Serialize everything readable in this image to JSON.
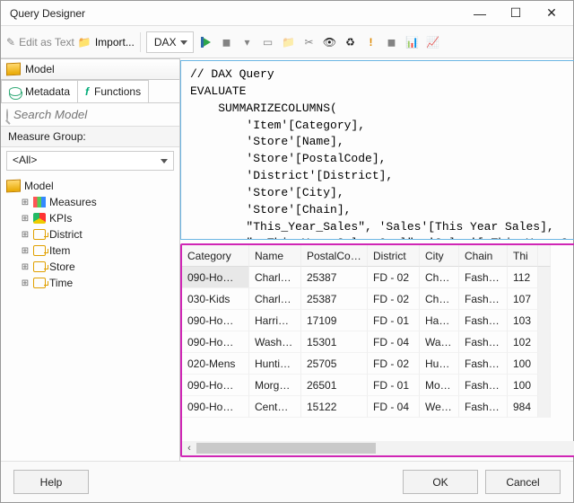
{
  "window": {
    "title": "Query Designer"
  },
  "toolbar": {
    "edit_as_text": "Edit as Text",
    "import": "Import...",
    "language": "DAX"
  },
  "left_panel": {
    "model_header": "Model",
    "tabs": {
      "metadata": "Metadata",
      "functions": "Functions"
    },
    "search_placeholder": "Search Model",
    "measure_group_label": "Measure Group:",
    "measure_group_value": "<All>",
    "tree": {
      "root": "Model",
      "children": [
        {
          "label": "Measures",
          "icon": "measures"
        },
        {
          "label": "KPIs",
          "icon": "kpis"
        },
        {
          "label": "District",
          "icon": "dim"
        },
        {
          "label": "Item",
          "icon": "dim"
        },
        {
          "label": "Store",
          "icon": "dim"
        },
        {
          "label": "Time",
          "icon": "dim"
        }
      ]
    }
  },
  "query": {
    "lines": [
      "// DAX Query",
      "EVALUATE",
      "    SUMMARIZECOLUMNS(",
      "        'Item'[Category],",
      "        'Store'[Name],",
      "        'Store'[PostalCode],",
      "        'District'[District],",
      "        'Store'[City],",
      "        'Store'[Chain],",
      "        \"This_Year_Sales\", 'Sales'[This Year Sales],",
      "        \"v_This_Year_Sales_Goal\", 'Sales'[_This Year Sales Goal],"
    ]
  },
  "grid": {
    "columns": [
      "Category",
      "Name",
      "PostalCode",
      "District",
      "City",
      "Chain",
      "Thi"
    ],
    "rows": [
      [
        "090-Ho…",
        "Charl…",
        "25387",
        "FD - 02",
        "Ch…",
        "Fashi…",
        "112"
      ],
      [
        "030-Kids",
        "Charl…",
        "25387",
        "FD - 02",
        "Ch…",
        "Fashi…",
        "107"
      ],
      [
        "090-Ho…",
        "Harri…",
        "17109",
        "FD - 01",
        "Ha…",
        "Fashi…",
        "103"
      ],
      [
        "090-Ho…",
        "Wash…",
        "15301",
        "FD - 04",
        "Wa…",
        "Fashi…",
        "102"
      ],
      [
        "020-Mens",
        "Hunti…",
        "25705",
        "FD - 02",
        "Hu…",
        "Fashi…",
        "100"
      ],
      [
        "090-Ho…",
        "Morg…",
        "26501",
        "FD - 01",
        "Mo…",
        "Fashi…",
        "100"
      ],
      [
        "090-Ho…",
        "Cent…",
        "15122",
        "FD - 04",
        "We…",
        "Fashi…",
        "984"
      ]
    ]
  },
  "footer": {
    "help": "Help",
    "ok": "OK",
    "cancel": "Cancel"
  },
  "chart_data": {
    "type": "table",
    "columns": [
      "Category",
      "Name",
      "PostalCode",
      "District",
      "City",
      "Chain",
      "This_Year_Sales_partial"
    ],
    "rows": [
      [
        "090-Ho…",
        "Charl…",
        "25387",
        "FD - 02",
        "Ch…",
        "Fashi…",
        "112"
      ],
      [
        "030-Kids",
        "Charl…",
        "25387",
        "FD - 02",
        "Ch…",
        "Fashi…",
        "107"
      ],
      [
        "090-Ho…",
        "Harri…",
        "17109",
        "FD - 01",
        "Ha…",
        "Fashi…",
        "103"
      ],
      [
        "090-Ho…",
        "Wash…",
        "15301",
        "FD - 04",
        "Wa…",
        "Fashi…",
        "102"
      ],
      [
        "020-Mens",
        "Hunti…",
        "25705",
        "FD - 02",
        "Hu…",
        "Fashi…",
        "100"
      ],
      [
        "090-Ho…",
        "Morg…",
        "26501",
        "FD - 01",
        "Mo…",
        "Fashi…",
        "100"
      ],
      [
        "090-Ho…",
        "Cent…",
        "15122",
        "FD - 04",
        "We…",
        "Fashi…",
        "984"
      ]
    ]
  }
}
